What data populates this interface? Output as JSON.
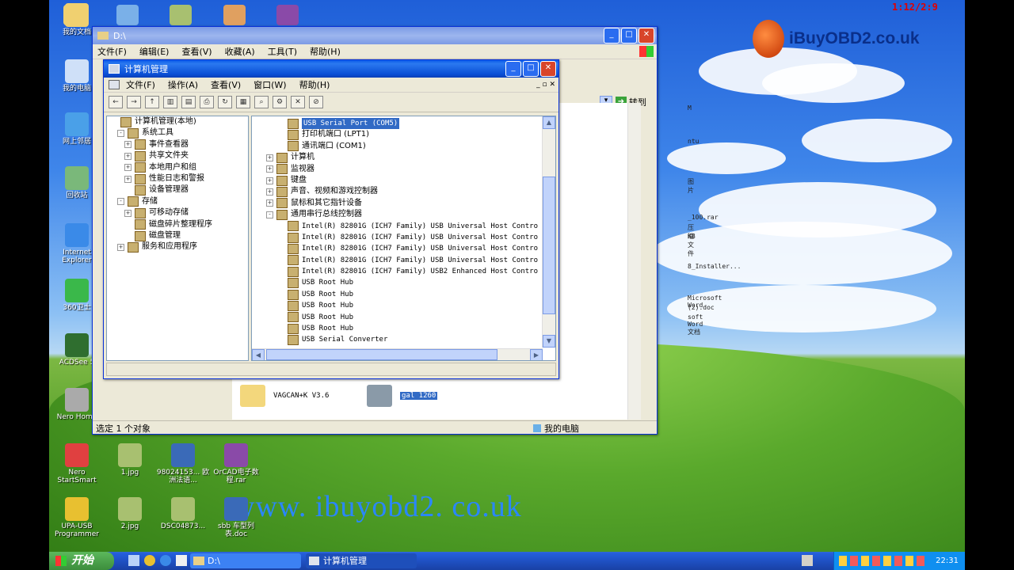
{
  "overlay": {
    "timer": "1:12/2:9",
    "brand": "iBuyOBD2.co.uk",
    "watermark": "www. ibuyobd2. co.uk"
  },
  "desktop_icons": [
    {
      "label": "我的文档",
      "icon": "my-documents-icon"
    },
    {
      "label": "我的电脑",
      "icon": "my-computer-icon"
    },
    {
      "label": "网上邻居",
      "icon": "network-icon"
    },
    {
      "label": "回收站",
      "icon": "recycle-bin-icon"
    },
    {
      "label": "Internet Explorer",
      "icon": "ie-icon"
    },
    {
      "label": "360卫士",
      "icon": "shield-icon"
    },
    {
      "label": "ACDSee 5",
      "icon": "acdsee-icon"
    },
    {
      "label": "Nero Home",
      "icon": "nero-icon"
    },
    {
      "label": "Nero StartSmart",
      "icon": "nero-startsmart-icon"
    },
    {
      "label": "1.jpg",
      "icon": "jpg-file-icon"
    },
    {
      "label": "98024153... 欧洲法语...",
      "icon": "word-file-icon"
    },
    {
      "label": "OrCAD电子数程.rar",
      "icon": "rar-file-icon"
    },
    {
      "label": "UPA-USB Programmer",
      "icon": "upa-usb-icon"
    },
    {
      "label": "2.jpg",
      "icon": "jpg-file-icon"
    },
    {
      "label": "DSC04873...",
      "icon": "jpg-file-icon"
    },
    {
      "label": "sbb 车型列表.doc",
      "icon": "word-file-icon"
    }
  ],
  "top_icons": [
    "folder-icon",
    "search-icon",
    "jpg-file-icon",
    "rabbit-icon",
    "rar-file-icon"
  ],
  "explorer": {
    "title": "D:\\",
    "menu": [
      "文件(F)",
      "编辑(E)",
      "查看(V)",
      "收藏(A)",
      "工具(T)",
      "帮助(H)"
    ],
    "goto": "转到",
    "right_snippets": [
      "M",
      "ntu",
      "图片",
      "_100.rar",
      "压缩文件",
      "KB",
      "8_Installer...",
      "Microsoft Word",
      "(2).doc",
      "soft Word 文档"
    ],
    "folders": [
      {
        "label": "VAGCAN+K V3.6"
      },
      {
        "label": "gal 1260"
      }
    ],
    "status_left": "选定 1 个对象",
    "status_right": "我的电脑"
  },
  "cm": {
    "title": "计算机管理",
    "menu": [
      "文件(F)",
      "操作(A)",
      "查看(V)",
      "窗口(W)",
      "帮助(H)"
    ],
    "tree": [
      {
        "label": "计算机管理(本地)",
        "level": 0,
        "exp": ""
      },
      {
        "label": "系统工具",
        "level": 1,
        "exp": "-"
      },
      {
        "label": "事件查看器",
        "level": 2,
        "exp": "+"
      },
      {
        "label": "共享文件夹",
        "level": 2,
        "exp": "+"
      },
      {
        "label": "本地用户和组",
        "level": 2,
        "exp": "+"
      },
      {
        "label": "性能日志和警报",
        "level": 2,
        "exp": "+"
      },
      {
        "label": "设备管理器",
        "level": 2,
        "exp": ""
      },
      {
        "label": "存储",
        "level": 1,
        "exp": "-"
      },
      {
        "label": "可移动存储",
        "level": 2,
        "exp": "+"
      },
      {
        "label": "磁盘碎片整理程序",
        "level": 2,
        "exp": ""
      },
      {
        "label": "磁盘管理",
        "level": 2,
        "exp": ""
      },
      {
        "label": "服务和应用程序",
        "level": 1,
        "exp": "+"
      }
    ],
    "devices": [
      {
        "label": "USB Serial Port (COM5)",
        "level": 2,
        "exp": "",
        "selected": true,
        "mono": true
      },
      {
        "label": "打印机端口 (LPT1)",
        "level": 2,
        "exp": "",
        "mono": false
      },
      {
        "label": "通讯端口 (COM1)",
        "level": 2,
        "exp": "",
        "mono": false
      },
      {
        "label": "计算机",
        "level": 1,
        "exp": "+",
        "mono": false
      },
      {
        "label": "监视器",
        "level": 1,
        "exp": "+",
        "mono": false
      },
      {
        "label": "键盘",
        "level": 1,
        "exp": "+",
        "mono": false
      },
      {
        "label": "声音、视频和游戏控制器",
        "level": 1,
        "exp": "+",
        "mono": false
      },
      {
        "label": "鼠标和其它指针设备",
        "level": 1,
        "exp": "+",
        "mono": false
      },
      {
        "label": "通用串行总线控制器",
        "level": 1,
        "exp": "-",
        "mono": false
      },
      {
        "label": "Intel(R) 82801G (ICH7 Family) USB Universal Host Contro",
        "level": 2,
        "exp": "",
        "mono": true
      },
      {
        "label": "Intel(R) 82801G (ICH7 Family) USB Universal Host Contro",
        "level": 2,
        "exp": "",
        "mono": true
      },
      {
        "label": "Intel(R) 82801G (ICH7 Family) USB Universal Host Contro",
        "level": 2,
        "exp": "",
        "mono": true
      },
      {
        "label": "Intel(R) 82801G (ICH7 Family) USB Universal Host Contro",
        "level": 2,
        "exp": "",
        "mono": true
      },
      {
        "label": "Intel(R) 82801G (ICH7 Family) USB2 Enhanced Host Contro",
        "level": 2,
        "exp": "",
        "mono": true
      },
      {
        "label": "USB Root Hub",
        "level": 2,
        "exp": "",
        "mono": true
      },
      {
        "label": "USB Root Hub",
        "level": 2,
        "exp": "",
        "mono": true
      },
      {
        "label": "USB Root Hub",
        "level": 2,
        "exp": "",
        "mono": true
      },
      {
        "label": "USB Root Hub",
        "level": 2,
        "exp": "",
        "mono": true
      },
      {
        "label": "USB Root Hub",
        "level": 2,
        "exp": "",
        "mono": true
      },
      {
        "label": "USB Serial Converter",
        "level": 2,
        "exp": "",
        "mono": true
      }
    ]
  },
  "taskbar": {
    "start": "开始",
    "task1": "D:\\",
    "task2": "计算机管理",
    "clock": "22:31"
  }
}
